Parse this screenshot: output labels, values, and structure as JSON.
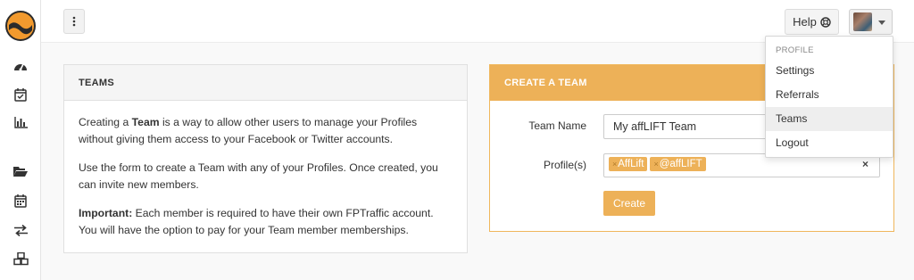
{
  "sidebar": {
    "icons": [
      "logo",
      "dashboard-icon",
      "calendar-check-icon",
      "bar-chart-icon",
      "folder-open-icon",
      "calendar-icon",
      "exchange-icon",
      "cubes-icon"
    ]
  },
  "topbar": {
    "help_label": "Help"
  },
  "teams_panel": {
    "title": "TEAMS",
    "p1_pre": "Creating a ",
    "p1_bold": "Team",
    "p1_post": " is a way to allow other users to manage your Profiles without giving them access to your Facebook or Twitter accounts.",
    "p2": "Use the form to create a Team with any of your Profiles. Once created, you can invite new members.",
    "p3_bold": "Important:",
    "p3_post": " Each member is required to have their own FPTraffic account. You will have the option to pay for your Team member memberships."
  },
  "create_panel": {
    "title": "CREATE A TEAM",
    "team_name_label": "Team Name",
    "team_name_value": "My affLIFT Team",
    "profiles_label": "Profile(s)",
    "profile_tags": [
      "AffLift",
      "@affLIFT"
    ],
    "clear_symbol": "×",
    "tag_remove_symbol": "×",
    "create_label": "Create"
  },
  "dropdown": {
    "header": "PROFILE",
    "items": [
      {
        "label": "Settings",
        "active": false
      },
      {
        "label": "Referrals",
        "active": false
      },
      {
        "label": "Teams",
        "active": true
      },
      {
        "label": "Logout",
        "active": false
      }
    ]
  },
  "colors": {
    "accent": "#edb158",
    "logo_orange": "#f29a2e",
    "logo_dark": "#2b2b2b"
  }
}
